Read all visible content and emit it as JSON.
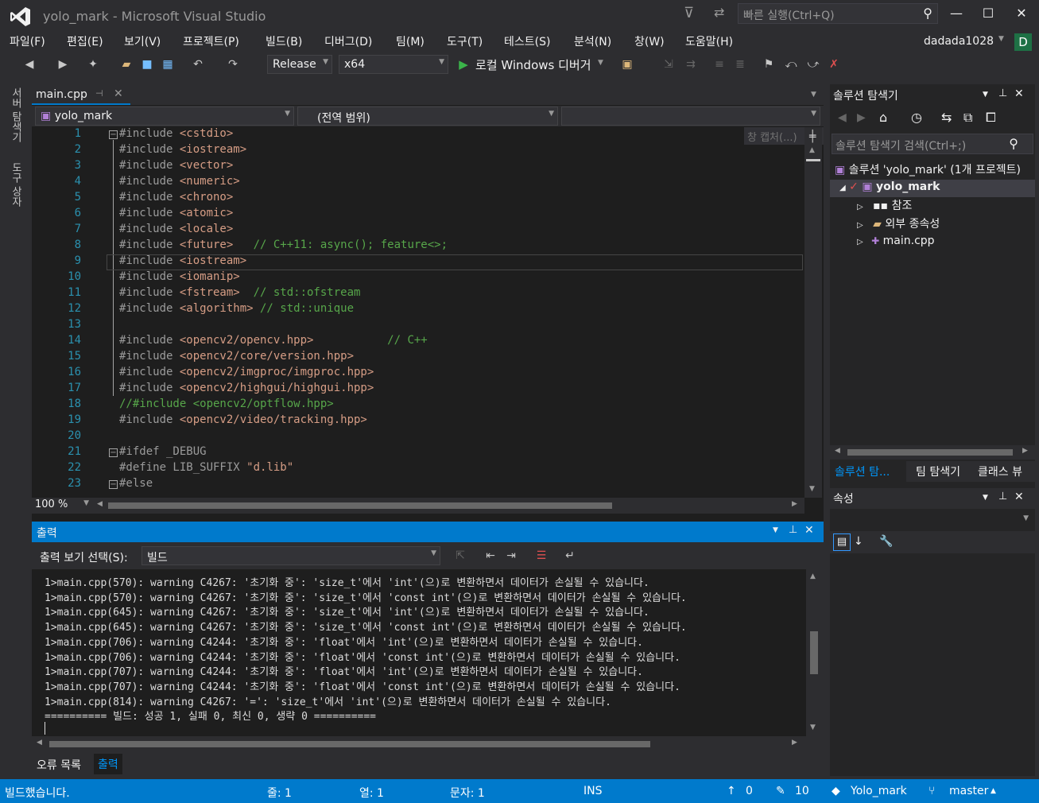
{
  "window": {
    "title": "yolo_mark - Microsoft Visual Studio",
    "quick_launch_placeholder": "빠른 실행(Ctrl+Q)",
    "user": "dadada1028",
    "avatar_letter": "D"
  },
  "menu": [
    "파일(F)",
    "편집(E)",
    "보기(V)",
    "프로젝트(P)",
    "빌드(B)",
    "디버그(D)",
    "팀(M)",
    "도구(T)",
    "테스트(S)",
    "분석(N)",
    "창(W)",
    "도움말(H)"
  ],
  "toolbar": {
    "config": "Release",
    "platform": "x64",
    "debugger": "로컬 Windows 디버거"
  },
  "side_tabs": [
    "서버 탐색기",
    "도구 상자"
  ],
  "editor": {
    "tab": "main.cpp",
    "project_dropdown": "yolo_mark",
    "scope_dropdown": "(전역 범위)",
    "zoom": "100 %",
    "watermark": "창 캡처(...)",
    "lines": [
      {
        "n": "1",
        "code": "#include ",
        "inc": "<cstdio>",
        "cm": ""
      },
      {
        "n": "2",
        "code": "#include ",
        "inc": "<iostream>",
        "cm": ""
      },
      {
        "n": "3",
        "code": "#include ",
        "inc": "<vector>",
        "cm": ""
      },
      {
        "n": "4",
        "code": "#include ",
        "inc": "<numeric>",
        "cm": ""
      },
      {
        "n": "5",
        "code": "#include ",
        "inc": "<chrono>",
        "cm": ""
      },
      {
        "n": "6",
        "code": "#include ",
        "inc": "<atomic>",
        "cm": ""
      },
      {
        "n": "7",
        "code": "#include ",
        "inc": "<locale>",
        "cm": ""
      },
      {
        "n": "8",
        "code": "#include ",
        "inc": "<future>",
        "cm": "   // C++11: async(); feature<>;"
      },
      {
        "n": "9",
        "code": "#include ",
        "inc": "<iostream>",
        "cm": ""
      },
      {
        "n": "10",
        "code": "#include ",
        "inc": "<iomanip>",
        "cm": ""
      },
      {
        "n": "11",
        "code": "#include ",
        "inc": "<fstream>",
        "cm": "  // std::ofstream"
      },
      {
        "n": "12",
        "code": "#include ",
        "inc": "<algorithm>",
        "cm": " // std::unique"
      },
      {
        "n": "13",
        "code": "",
        "inc": "",
        "cm": ""
      },
      {
        "n": "14",
        "code": "#include ",
        "inc": "<opencv2/opencv.hpp>",
        "cm": "           // C++"
      },
      {
        "n": "15",
        "code": "#include ",
        "inc": "<opencv2/core/version.hpp>",
        "cm": ""
      },
      {
        "n": "16",
        "code": "#include ",
        "inc": "<opencv2/imgproc/imgproc.hpp>",
        "cm": ""
      },
      {
        "n": "17",
        "code": "#include ",
        "inc": "<opencv2/highgui/highgui.hpp>",
        "cm": ""
      },
      {
        "n": "18",
        "code": "",
        "inc": "",
        "cm": "//#include <opencv2/optflow.hpp>"
      },
      {
        "n": "19",
        "code": "#include ",
        "inc": "<opencv2/video/tracking.hpp>",
        "cm": ""
      },
      {
        "n": "20",
        "code": "",
        "inc": "",
        "cm": ""
      },
      {
        "n": "21",
        "code": "#ifdef _DEBUG",
        "inc": "",
        "cm": ""
      },
      {
        "n": "22",
        "code": "#define LIB_SUFFIX ",
        "inc": "\"d.lib\"",
        "cm": ""
      },
      {
        "n": "23",
        "code": "#else",
        "inc": "",
        "cm": ""
      }
    ]
  },
  "output": {
    "title": "출력",
    "source_label": "출력 보기 선택(S):",
    "source_value": "빌드",
    "lines": [
      "1>main.cpp(570): warning C4267: '초기화 중': 'size_t'에서 'int'(으)로 변환하면서 데이터가 손실될 수 있습니다.",
      "1>main.cpp(570): warning C4267: '초기화 중': 'size_t'에서 'const int'(으)로 변환하면서 데이터가 손실될 수 있습니다.",
      "1>main.cpp(645): warning C4267: '초기화 중': 'size_t'에서 'int'(으)로 변환하면서 데이터가 손실될 수 있습니다.",
      "1>main.cpp(645): warning C4267: '초기화 중': 'size_t'에서 'const int'(으)로 변환하면서 데이터가 손실될 수 있습니다.",
      "1>main.cpp(706): warning C4244: '초기화 중': 'float'에서 'int'(으)로 변환하면서 데이터가 손실될 수 있습니다.",
      "1>main.cpp(706): warning C4244: '초기화 중': 'float'에서 'const int'(으)로 변환하면서 데이터가 손실될 수 있습니다.",
      "1>main.cpp(707): warning C4244: '초기화 중': 'float'에서 'int'(으)로 변환하면서 데이터가 손실될 수 있습니다.",
      "1>main.cpp(707): warning C4244: '초기화 중': 'float'에서 'const int'(으)로 변환하면서 데이터가 손실될 수 있습니다.",
      "1>main.cpp(814): warning C4267: '=': 'size_t'에서 'int'(으)로 변환하면서 데이터가 손실될 수 있습니다.",
      "========== 빌드: 성공 1, 실패 0, 최신 0, 생략 0 =========="
    ]
  },
  "bottom_tabs": [
    "오류 목록",
    "출력"
  ],
  "solution": {
    "title": "솔루션 탐색기",
    "search_placeholder": "솔루션 탐색기 검색(Ctrl+;)",
    "root": "솔루션 'yolo_mark' (1개 프로젝트)",
    "project": "yolo_mark",
    "items": [
      "참조",
      "외부 종속성",
      "main.cpp"
    ],
    "tabs": [
      "솔루션 탐...",
      "팀 탐색기",
      "클래스 뷰"
    ]
  },
  "properties": {
    "title": "속성"
  },
  "status": {
    "message": "빌드했습니다.",
    "line": "줄: 1",
    "col": "열: 1",
    "ch": "문자: 1",
    "mode": "INS",
    "up": "0",
    "edits": "10",
    "repo": "Yolo_mark",
    "branch": "master"
  }
}
